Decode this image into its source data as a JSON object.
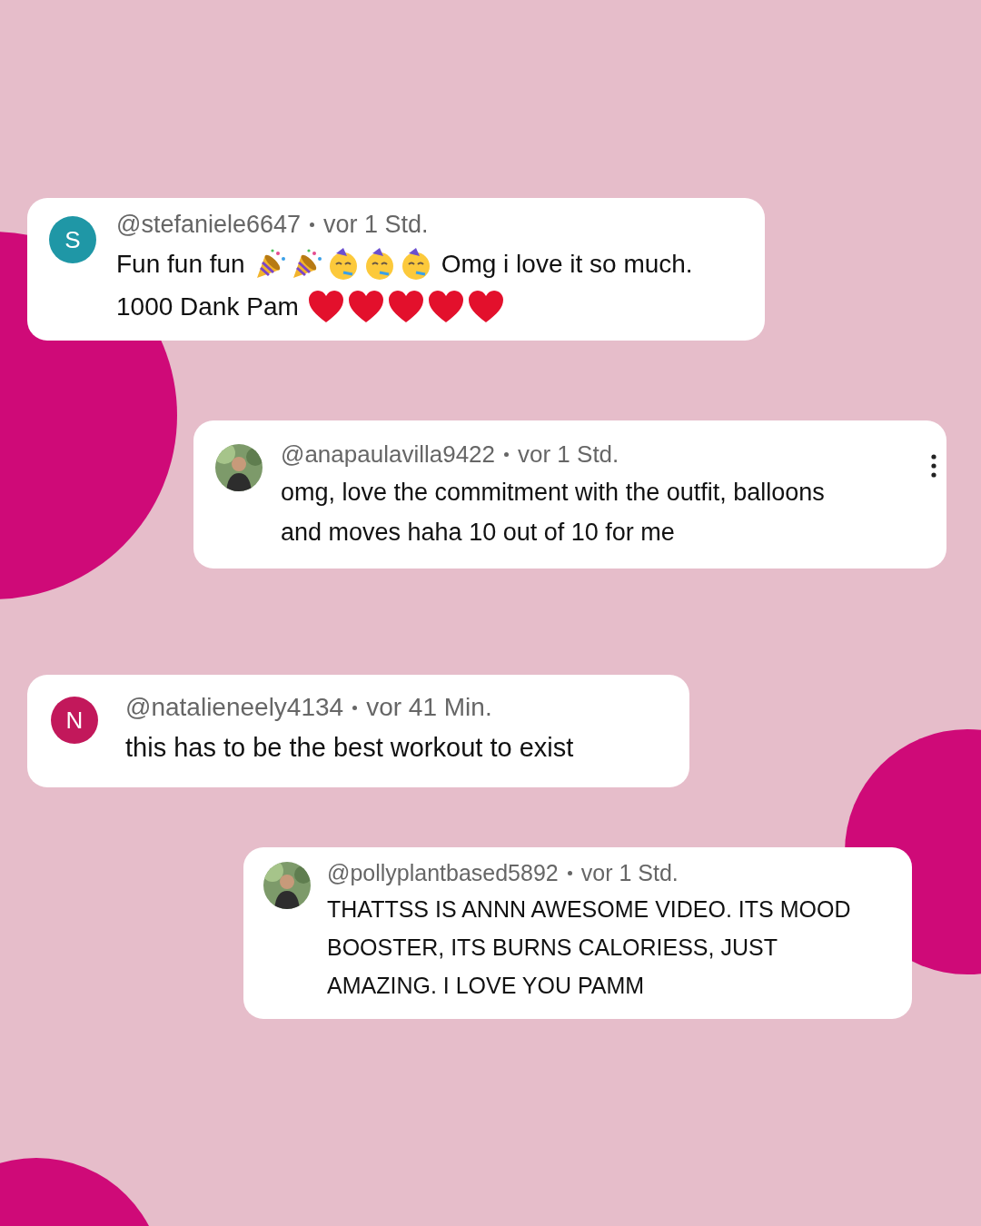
{
  "comments": [
    {
      "avatar": {
        "kind": "letter",
        "letter": "S",
        "color": "#1f97a6"
      },
      "handle": "@stefaniele6647",
      "time": "vor 1 Std.",
      "menu": false,
      "lines": [
        [
          {
            "kind": "text",
            "text": "Fun fun fun"
          },
          {
            "kind": "popper"
          },
          {
            "kind": "popper"
          },
          {
            "kind": "party-face"
          },
          {
            "kind": "party-face"
          },
          {
            "kind": "party-face"
          },
          {
            "kind": "text",
            "text": "Omg i love it so much."
          }
        ],
        [
          {
            "kind": "text",
            "text": "1000 Dank Pam"
          },
          {
            "kind": "heart"
          },
          {
            "kind": "heart"
          },
          {
            "kind": "heart"
          },
          {
            "kind": "heart"
          },
          {
            "kind": "heart"
          }
        ]
      ]
    },
    {
      "avatar": {
        "kind": "picture"
      },
      "handle": "@anapaulavilla9422",
      "time": "vor 1 Std.",
      "menu": true,
      "lines": [
        [
          {
            "kind": "text",
            "text": "omg, love the commitment with the outfit, balloons"
          }
        ],
        [
          {
            "kind": "text",
            "text": "and moves haha 10 out of 10 for me"
          }
        ]
      ]
    },
    {
      "avatar": {
        "kind": "letter",
        "letter": "N",
        "color": "#c2185b"
      },
      "handle": "@natalieneely4134",
      "time": "vor 41 Min.",
      "menu": false,
      "lines": [
        [
          {
            "kind": "text",
            "text": "this has to be the best workout to exist"
          }
        ]
      ]
    },
    {
      "avatar": {
        "kind": "picture"
      },
      "handle": "@pollyplantbased5892",
      "time": "vor 1 Std.",
      "menu": false,
      "lines": [
        [
          {
            "kind": "text",
            "text": "THATTSS IS ANNN AWESOME VIDEO. ITS MOOD"
          }
        ],
        [
          {
            "kind": "text",
            "text": "BOOSTER, ITS BURNS CALORIESS, JUST"
          }
        ],
        [
          {
            "kind": "text",
            "text": "AMAZING. I LOVE YOU PAMM"
          }
        ]
      ]
    }
  ]
}
